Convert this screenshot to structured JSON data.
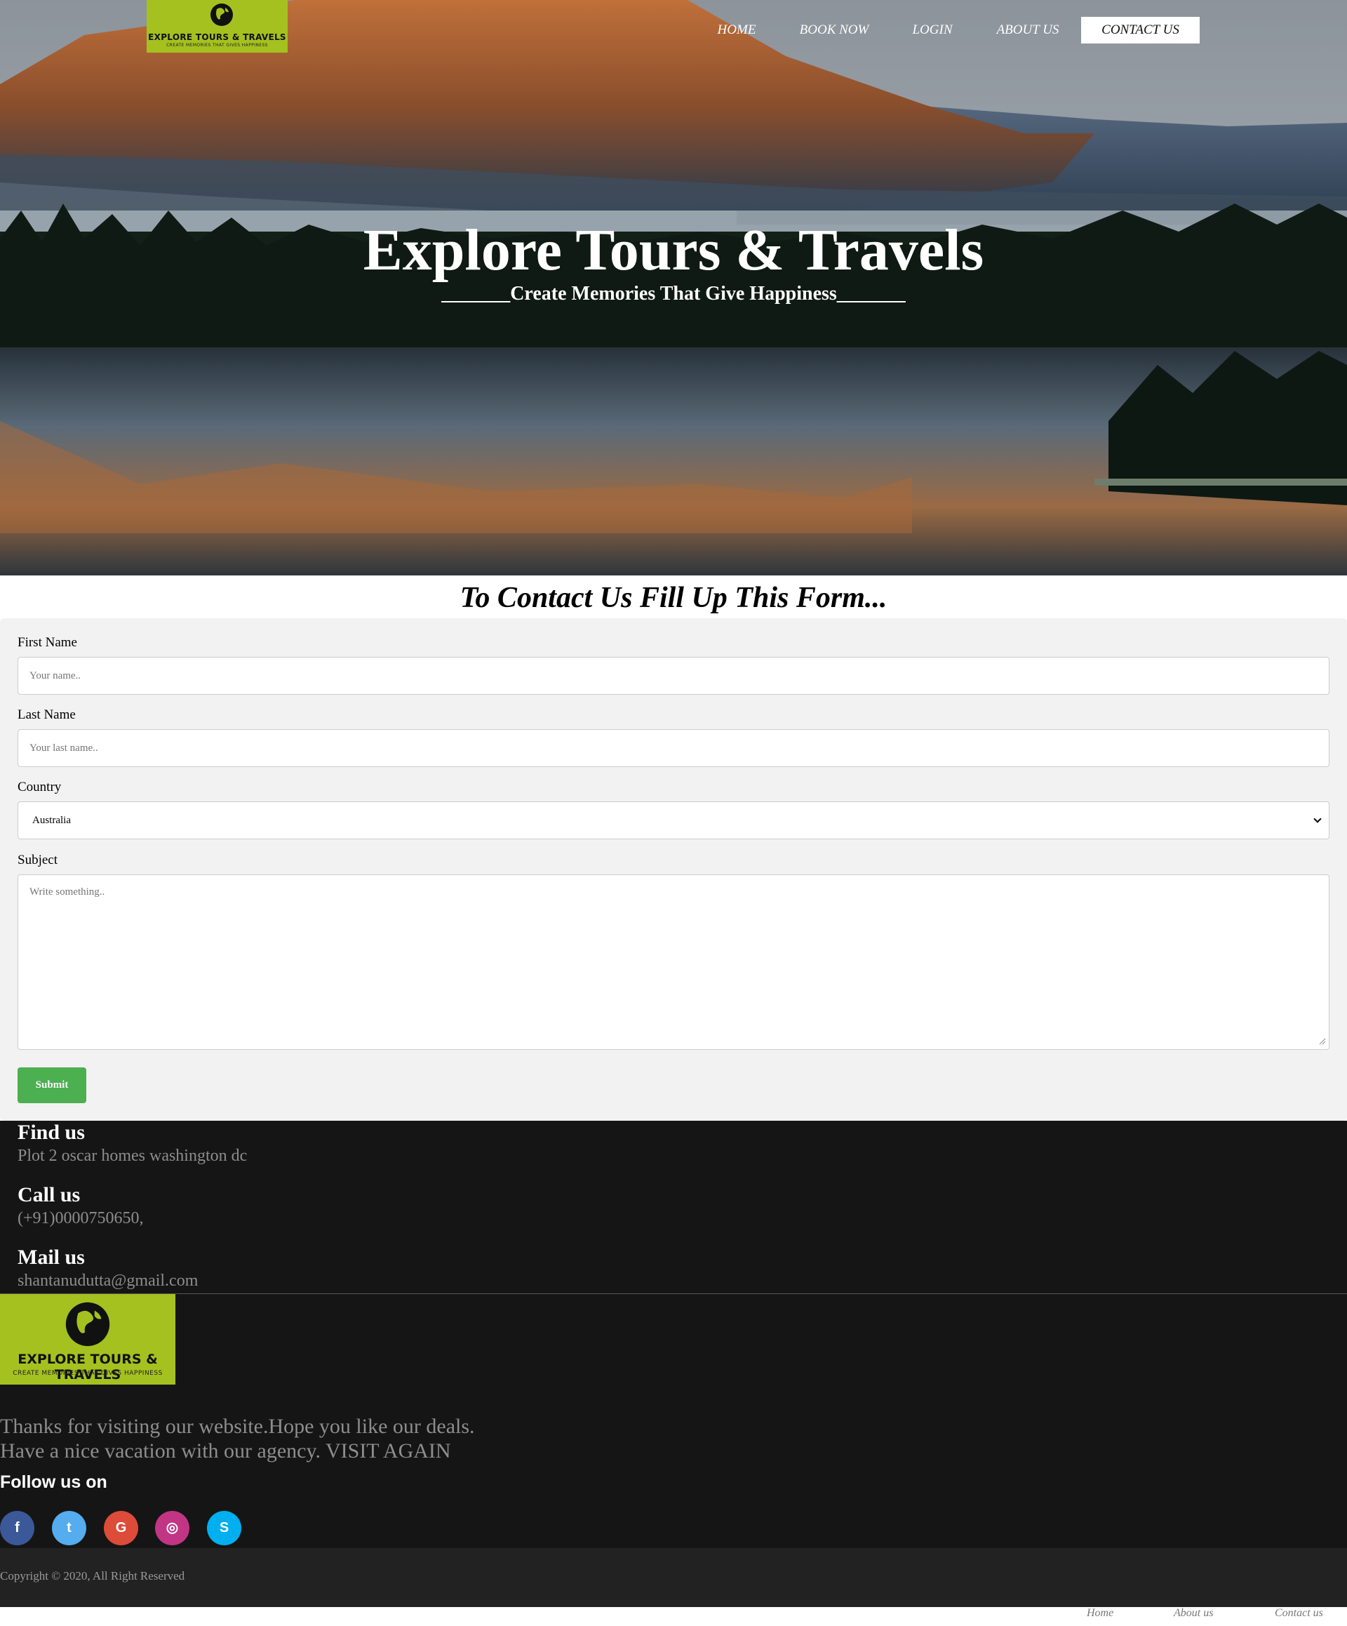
{
  "brand": {
    "logo_title": "EXPLORE TOURS & TRAVELS",
    "logo_tagline": "CREATE MEMORIES THAT GIVES HAPPINESS",
    "accent_color": "#a4c11f"
  },
  "nav": {
    "items": [
      {
        "label": "HOME"
      },
      {
        "label": "BOOK NOW"
      },
      {
        "label": "LOGIN"
      },
      {
        "label": "ABOUT US"
      },
      {
        "label": "CONTACT US",
        "active": true
      }
    ]
  },
  "hero": {
    "title": "Explore Tours & Travels",
    "subtitle": "_______Create Memories That Give Happiness_______"
  },
  "form": {
    "heading": "To Contact Us Fill Up This Form...",
    "first_name_label": "First Name",
    "first_name_placeholder": "Your name..",
    "last_name_label": "Last Name",
    "last_name_placeholder": "Your last name..",
    "country_label": "Country",
    "country_selected": "Australia",
    "subject_label": "Subject",
    "subject_placeholder": "Write something..",
    "submit_label": "Submit",
    "submit_color": "#4caf50"
  },
  "contact": {
    "find_heading": "Find us",
    "find_text": "Plot 2 oscar homes washington dc",
    "call_heading": "Call us",
    "call_text": "(+91)0000750650,",
    "mail_heading": "Mail us",
    "mail_text": "shantanudutta@gmail.com"
  },
  "footer": {
    "thanks_line1": "Thanks for visiting our website.Hope you like our deals.",
    "thanks_line2": "Have a nice vacation with our agency. VISIT AGAIN",
    "follow_heading": "Follow us on",
    "social": [
      {
        "icon": "facebook-icon",
        "glyph": "f",
        "color": "#3b5998"
      },
      {
        "icon": "twitter-icon",
        "glyph": "t",
        "color": "#55acee"
      },
      {
        "icon": "google-icon",
        "glyph": "G",
        "color": "#dd4b39"
      },
      {
        "icon": "instagram-icon",
        "glyph": "◎",
        "color": "#c13584"
      },
      {
        "icon": "skype-icon",
        "glyph": "S",
        "color": "#00aff0"
      }
    ],
    "copyright": "Copyright © 2020, All Right Reserved",
    "links": [
      {
        "label": "Home"
      },
      {
        "label": "About us"
      },
      {
        "label": "Contact us"
      }
    ]
  }
}
